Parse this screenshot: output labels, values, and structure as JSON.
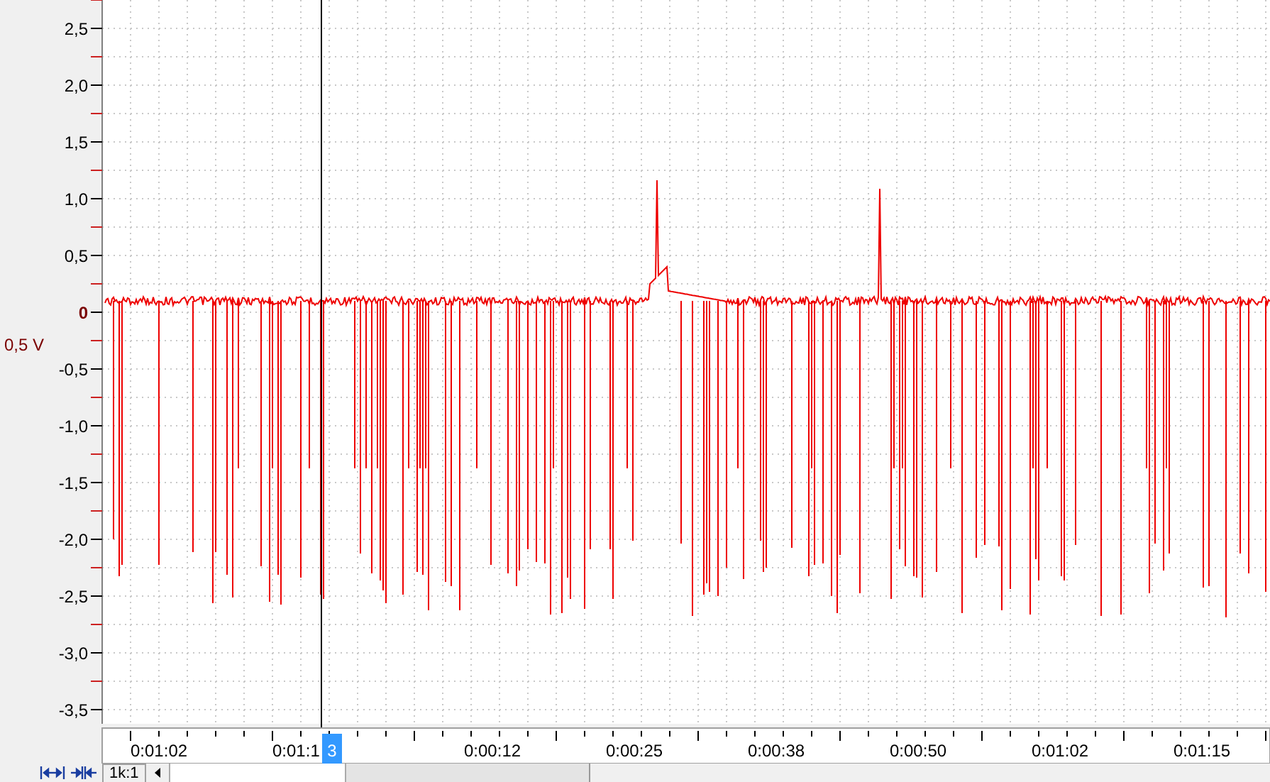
{
  "y_axis": {
    "ticks": [
      {
        "label": "2,5",
        "kind": "normal"
      },
      {
        "label": "2,0",
        "kind": "normal"
      },
      {
        "label": "1,5",
        "kind": "normal"
      },
      {
        "label": "1,0",
        "kind": "normal"
      },
      {
        "label": "0,5",
        "kind": "normal"
      },
      {
        "label": "0",
        "kind": "zero"
      },
      {
        "label": "-0,5",
        "kind": "normal"
      },
      {
        "label": "-1,0",
        "kind": "normal"
      },
      {
        "label": "-1,5",
        "kind": "normal"
      },
      {
        "label": "-2,0",
        "kind": "normal"
      },
      {
        "label": "-2,5",
        "kind": "normal"
      },
      {
        "label": "-3,0",
        "kind": "normal"
      },
      {
        "label": "-3,5",
        "kind": "normal"
      }
    ],
    "scale_label": "0,5 V"
  },
  "x_axis": {
    "ticks": [
      "0:01:02",
      "0:01:1",
      "0:00:12",
      "0:00:25",
      "0:00:38",
      "0:00:50",
      "0:01:02",
      "0:01:15"
    ],
    "cursor_label": "3"
  },
  "toolbar": {
    "zoom_ratio": "1k:1"
  }
}
